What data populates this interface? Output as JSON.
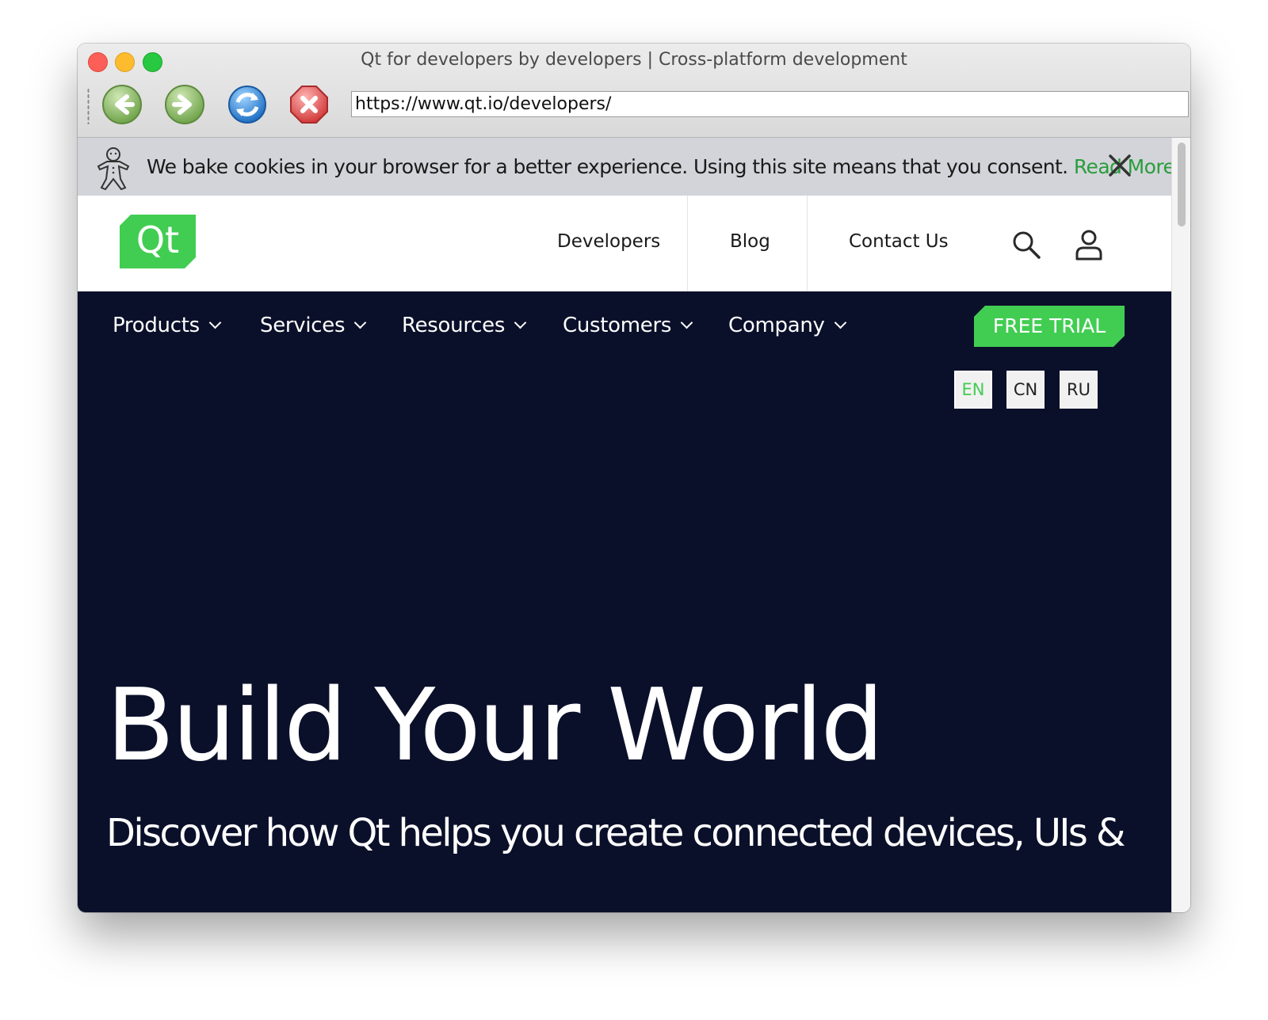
{
  "window": {
    "title": "Qt for developers by developers | Cross-platform development",
    "url": "https://www.qt.io/developers/"
  },
  "toolbar": {
    "back_icon": "back-arrow-icon",
    "forward_icon": "forward-arrow-icon",
    "reload_icon": "reload-icon",
    "stop_icon": "stop-icon"
  },
  "cookie_banner": {
    "text": "We bake cookies in your browser for a better experience. Using this site means that you consent.",
    "link": "Read More",
    "link_color": "#2a9d3d",
    "icon": "gingerbread-man-icon",
    "close_icon": "close-icon"
  },
  "header": {
    "logo_text": "Qt",
    "links": [
      "Developers",
      "Blog",
      "Contact Us"
    ],
    "search_icon": "search-icon",
    "account_icon": "user-icon"
  },
  "nav": {
    "items": [
      "Products",
      "Services",
      "Resources",
      "Customers",
      "Company"
    ],
    "cta": "FREE TRIAL"
  },
  "languages": {
    "options": [
      "EN",
      "CN",
      "RU"
    ],
    "selected": "EN"
  },
  "hero": {
    "title": "Build Your World",
    "subtitle": "Discover how Qt helps you create connected devices, UIs &"
  },
  "colors": {
    "brand_green": "#41cd52",
    "dark_background": "#0b102a",
    "cookie_background": "#d3d4d9"
  }
}
